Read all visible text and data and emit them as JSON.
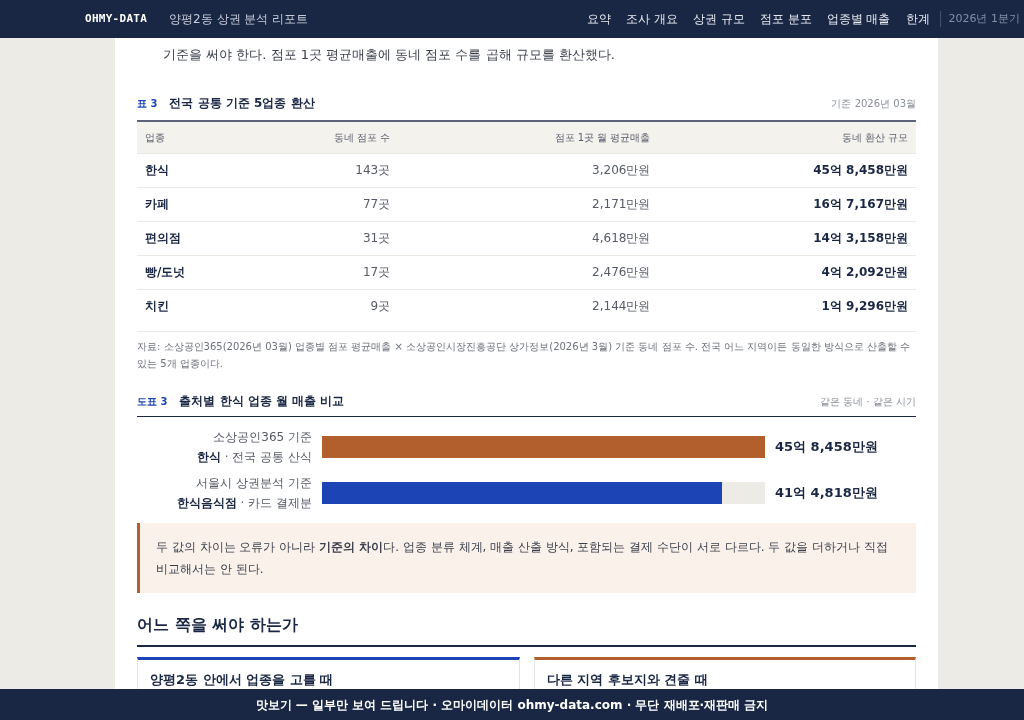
{
  "header": {
    "brand": "OHMY-DATA",
    "title": "양평2동 상권 분석 리포트",
    "nav": [
      {
        "label": "요약",
        "selected": false
      },
      {
        "label": "조사 개요",
        "selected": false
      },
      {
        "label": "상권 규모",
        "selected": false
      },
      {
        "label": "점포 분포",
        "selected": false
      },
      {
        "label": "업종별 매출",
        "selected": false
      },
      {
        "label": "한계",
        "selected": false
      }
    ],
    "period": "2026년 1분기"
  },
  "intro": "기준을 써야 한다. 점포 1곳 평균매출에 동네 점포 수를 곱해 규모를 환산했다.",
  "table": {
    "label": "표 3",
    "title": "전국 공통 기준 5업종 환산",
    "note": "기준 2026년 03월",
    "columns": [
      "업종",
      "동네 점포 수",
      "점포 1곳 월 평균매출",
      "동네 환산 규모"
    ],
    "rows": [
      [
        "한식",
        "143곳",
        "3,206만원",
        "45억 8,458만원"
      ],
      [
        "카페",
        "77곳",
        "2,171만원",
        "16억 7,167만원"
      ],
      [
        "편의점",
        "31곳",
        "4,618만원",
        "14억 3,158만원"
      ],
      [
        "빵/도넛",
        "17곳",
        "2,476만원",
        "4억 2,092만원"
      ],
      [
        "치킨",
        "9곳",
        "2,144만원",
        "1억 9,296만원"
      ]
    ],
    "source": "자료: 소상공인365(2026년 03월) 업종별 점포 평균매출 × 소상공인시장진흥공단 상가정보(2026년 3월) 기준 동네 점포 수. 전국 어느 지역이든 동일한 방식으로 산출할 수 있는 5개 업종이다."
  },
  "chart": {
    "label": "도표 3",
    "title": "출처별 한식 업종 월 매출 비교",
    "note": "같은 동네 · 같은 시기",
    "bars": [
      {
        "source": "소상공인365 기준",
        "category": "한식",
        "detail": " · 전국 공통 산식",
        "value": "45억 8,458만원",
        "level": 1,
        "color": "#b25f2d"
      },
      {
        "source": "서울시 상권분석 기준",
        "category": "한식음식점",
        "detail": " · 카드 결제분",
        "value": "41억 4,818만원",
        "level": 0.903,
        "color": "#1c44b4"
      }
    ]
  },
  "callout": "두 값의 차이는 오류가 아니라 **기준의 차이**다. 업종 분류 체계, 매출 산출 방식, 포함되는 결제 수단이 서로 다르다. 두 값을 더하거나 직접 비교해서는 안 된다.",
  "section": {
    "heading": "어느 쪽을 써야 하는가",
    "cards": [
      {
        "title": "양평2동 안에서 업종을 고를 때",
        "color": "#1c44b4"
      },
      {
        "title": "다른 지역 후보지와 견줄 때",
        "color": "#b25f2d"
      }
    ]
  },
  "banner": "맛보기 — 일부만 보여 드립니다 · 오마이데이터 ohmy-data.com · 무단 재배포·재판매 금지"
}
